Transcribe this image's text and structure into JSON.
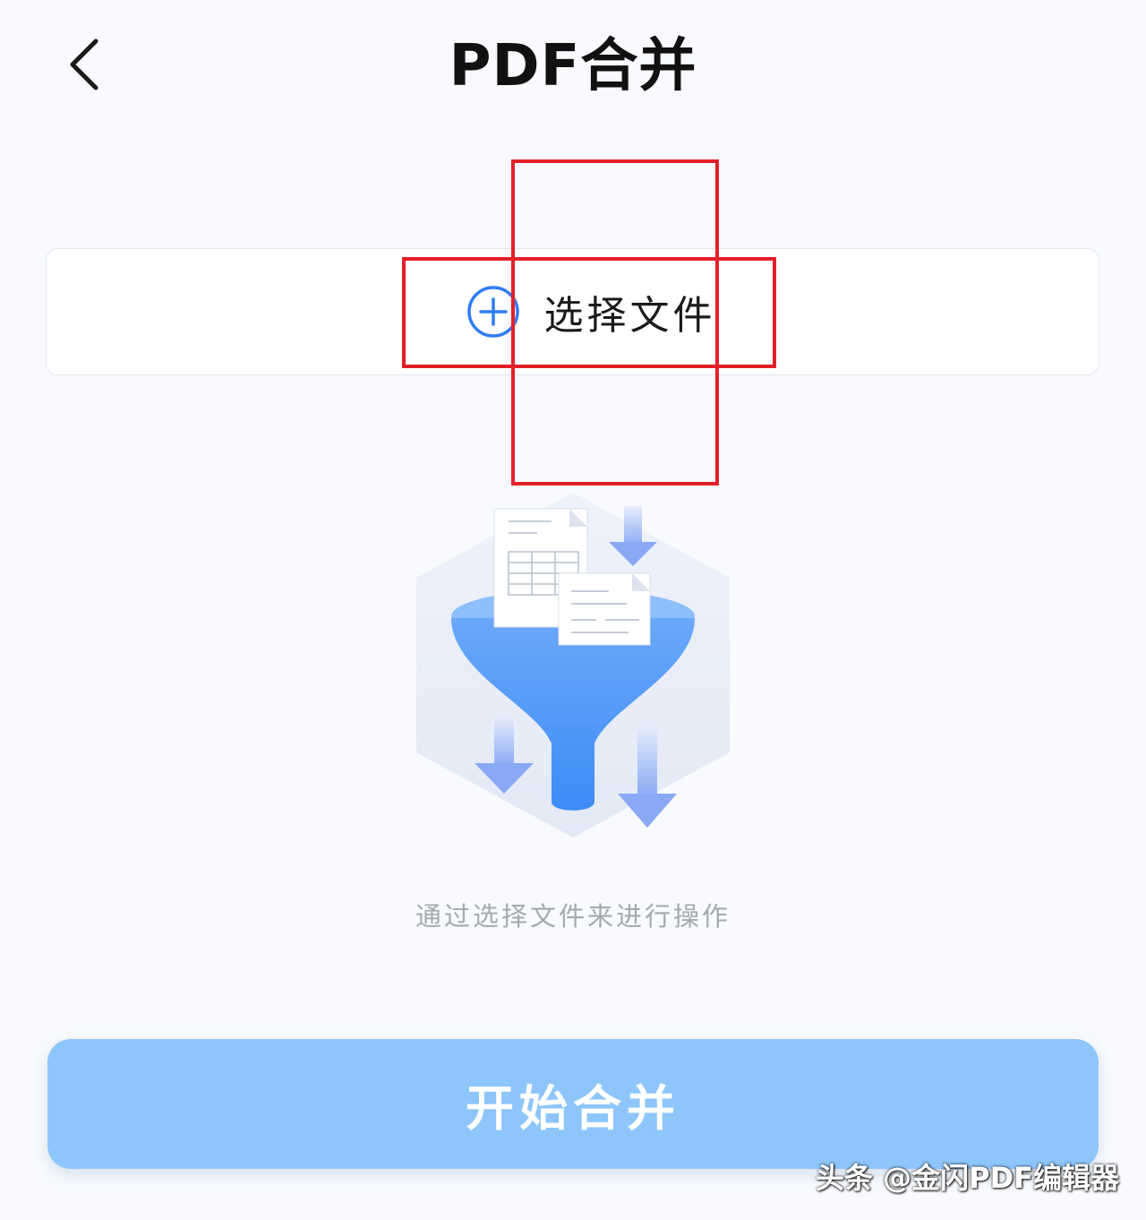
{
  "header": {
    "title": "PDF合并",
    "back_icon": "chevron-left-icon"
  },
  "select_file": {
    "label": "选择文件",
    "icon": "plus-circle-icon",
    "icon_color": "#2f7cf6"
  },
  "illustration": {
    "icon": "funnel-merge-illustration"
  },
  "hint": "通过选择文件来进行操作",
  "primary_action": {
    "label": "开始合并",
    "color": "#8ec6fb"
  },
  "annotation": {
    "color": "#e3202a"
  },
  "watermark": "头条 @金闪PDF编辑器"
}
